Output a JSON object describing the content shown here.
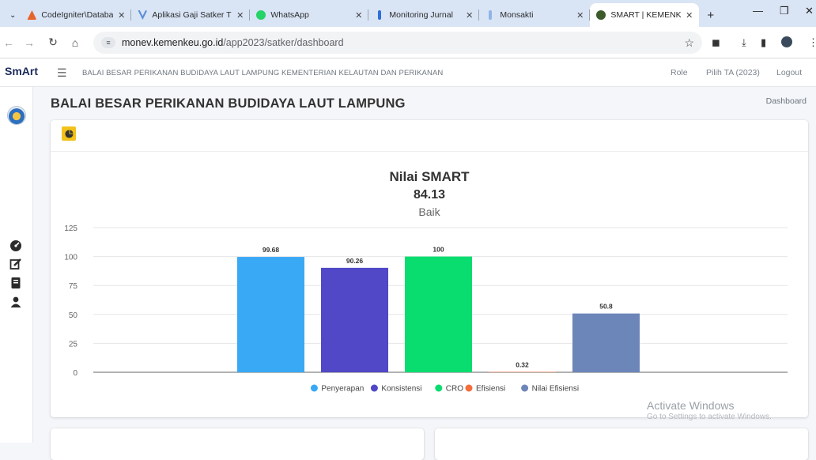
{
  "browser": {
    "tabs": [
      {
        "title": "CodeIgniter\\Databas",
        "color": "#e8632b"
      },
      {
        "title": "Aplikasi Gaji Satker T",
        "color": "#5b8fd6"
      },
      {
        "title": "WhatsApp",
        "color": "#25d366"
      },
      {
        "title": "Monitoring Jurnal",
        "color": "#2f6fd6"
      },
      {
        "title": "Monsakti",
        "color": "#8fb4e8"
      },
      {
        "title": "SMART | KEMENKEU",
        "color": "#3c5a2a"
      }
    ],
    "url_host": "monev.kemenkeu.go.id",
    "url_path": "/app2023/satker/dashboard"
  },
  "app": {
    "logo": "SmArt",
    "org_name": "BALAI BESAR PERIKANAN BUDIDAYA LAUT LAMPUNG KEMENTERIAN KELAUTAN DAN PERIKANAN",
    "header_links": [
      "Role",
      "Pilih TA (2023)",
      "Logout"
    ]
  },
  "page": {
    "title": "BALAI BESAR PERIKANAN BUDIDAYA LAUT LAMPUNG",
    "breadcrumb": "Dashboard"
  },
  "chart_data": {
    "type": "bar",
    "title": "Nilai SMART",
    "subtitle_value": "84.13",
    "subtitle_label": "Baik",
    "categories": [
      "Penyerapan",
      "Konsistensi",
      "CRO",
      "Efisiensi",
      "Nilai Efisiensi"
    ],
    "values": [
      99.68,
      90.26,
      100,
      0.32,
      50.8
    ],
    "data_labels": [
      "99.68",
      "90.26",
      "100",
      "0.32",
      "50.8"
    ],
    "colors": [
      "#39a9f5",
      "#5048c6",
      "#09dd6f",
      "#f56d3a",
      "#6d86b9"
    ],
    "yticks": [
      0,
      25,
      50,
      75,
      100,
      125
    ],
    "ylim": [
      0,
      125
    ],
    "grid": true,
    "legend": "bottom"
  },
  "os": {
    "activate_title": "Activate Windows",
    "activate_sub": "Go to Settings to activate Windows."
  }
}
